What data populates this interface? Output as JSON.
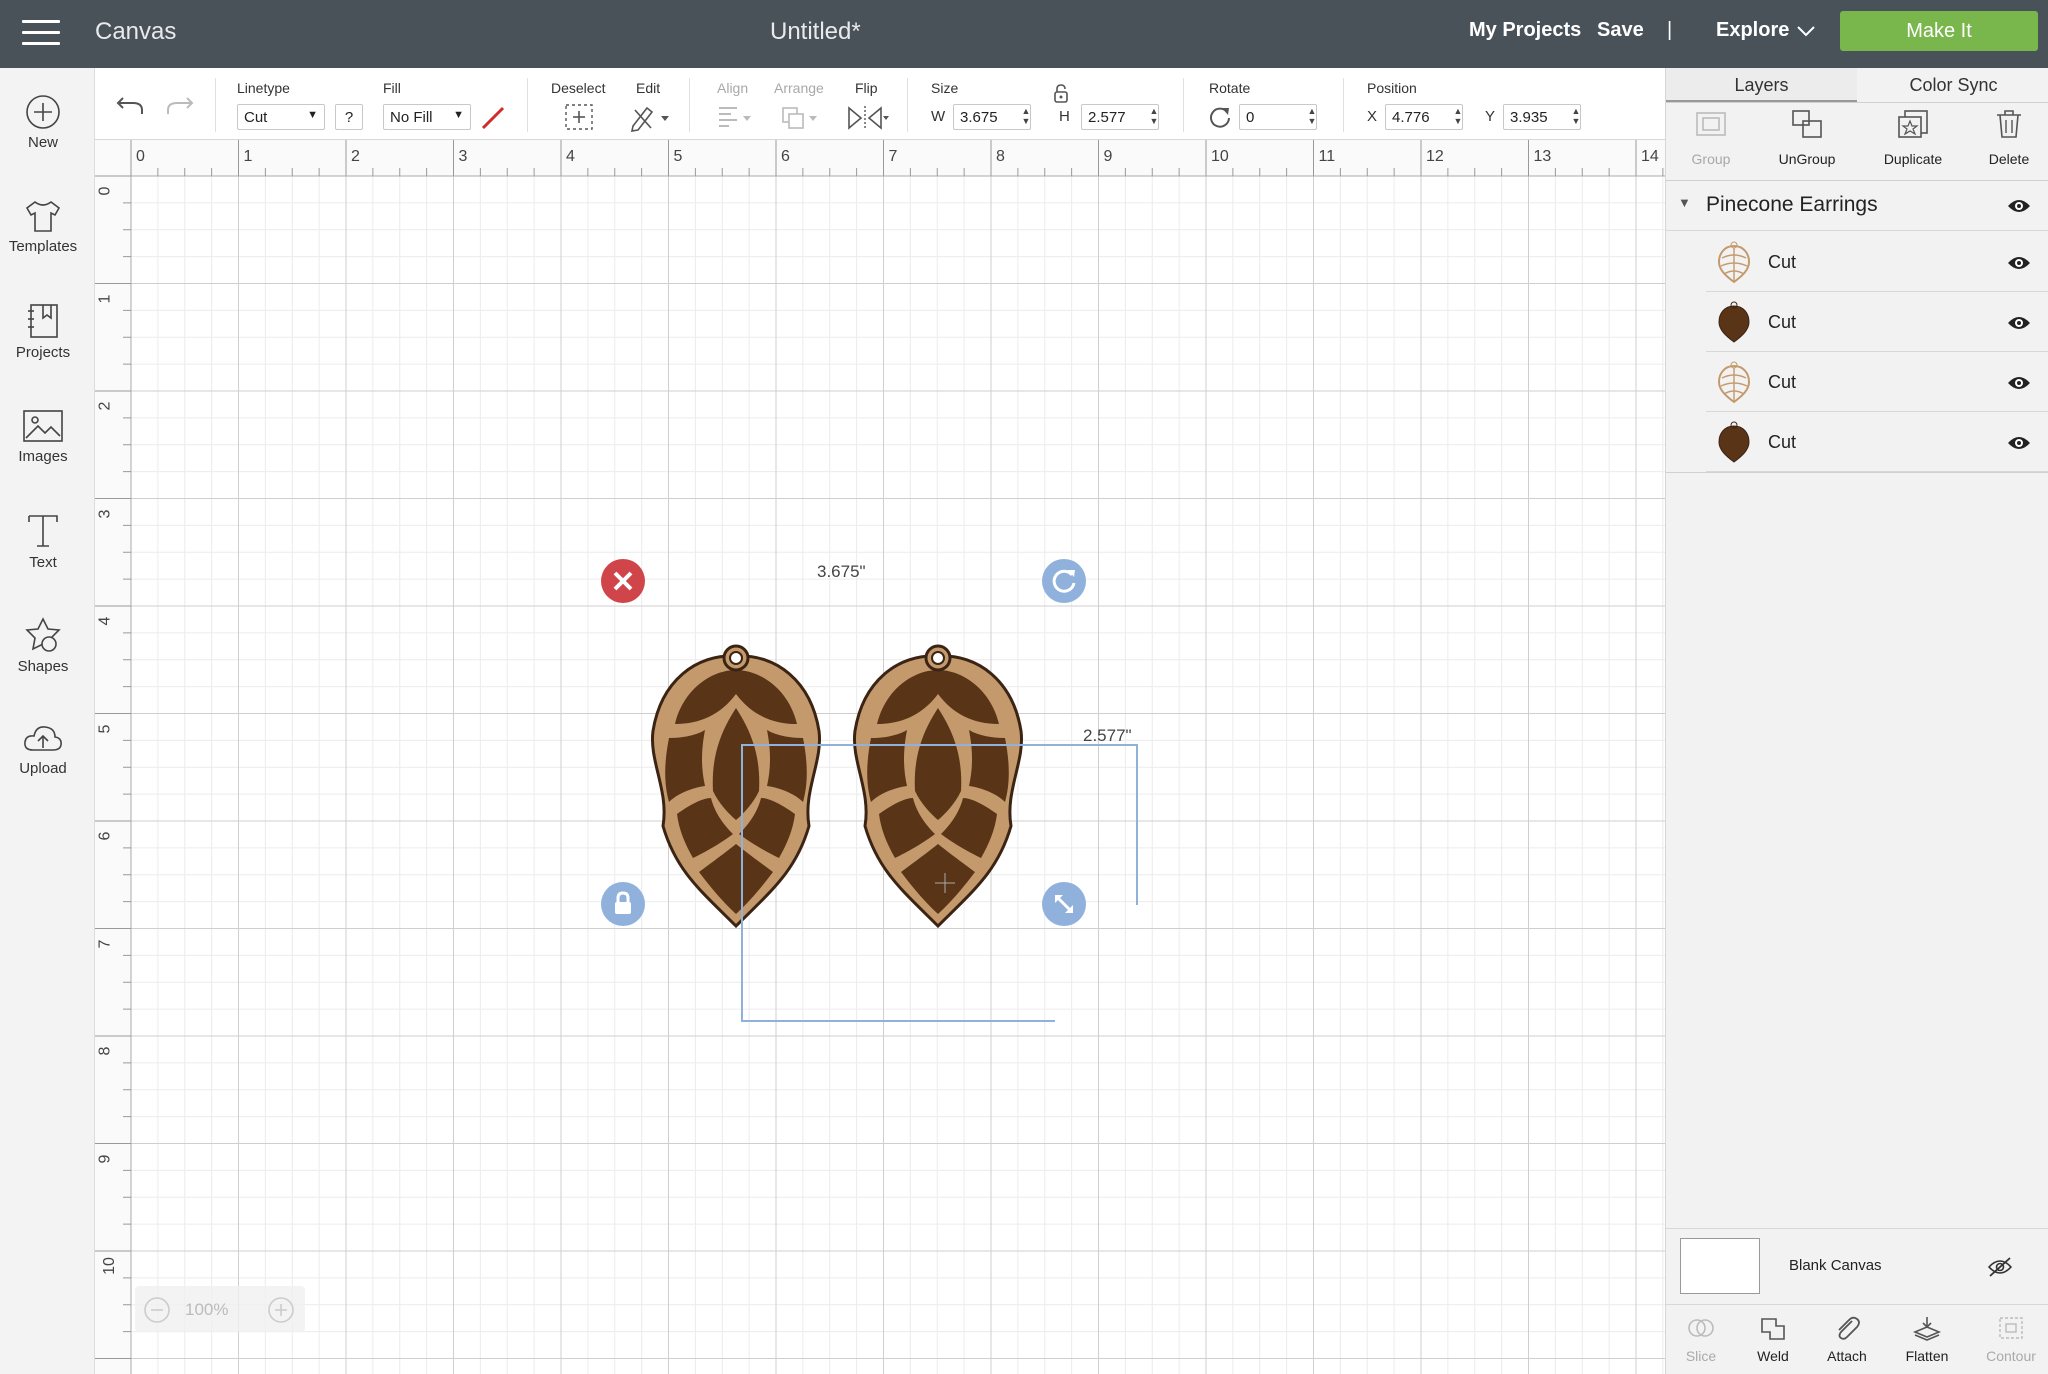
{
  "topbar": {
    "app_title": "Canvas",
    "doc_title": "Untitled*",
    "my_projects": "My Projects",
    "save": "Save",
    "divider": "|",
    "explore": "Explore",
    "make_it": "Make It"
  },
  "sidebar": {
    "items": [
      {
        "label": "New",
        "icon": "plus-circle-icon"
      },
      {
        "label": "Templates",
        "icon": "tshirt-icon"
      },
      {
        "label": "Projects",
        "icon": "notebook-icon"
      },
      {
        "label": "Images",
        "icon": "image-icon"
      },
      {
        "label": "Text",
        "icon": "text-icon"
      },
      {
        "label": "Shapes",
        "icon": "shapes-icon"
      },
      {
        "label": "Upload",
        "icon": "cloud-upload-icon"
      }
    ]
  },
  "toolbar": {
    "linetype_label": "Linetype",
    "linetype_value": "Cut",
    "help": "?",
    "fill_label": "Fill",
    "fill_value": "No Fill",
    "deselect_label": "Deselect",
    "edit_label": "Edit",
    "align_label": "Align",
    "arrange_label": "Arrange",
    "flip_label": "Flip",
    "size_label": "Size",
    "w_label": "W",
    "w_value": "3.675",
    "h_label": "H",
    "h_value": "2.577",
    "rotate_label": "Rotate",
    "rotate_value": "0",
    "position_label": "Position",
    "x_label": "X",
    "x_value": "4.776",
    "y_label": "Y",
    "y_value": "3.935"
  },
  "canvas": {
    "ruler_h": [
      "0",
      "1",
      "2",
      "3",
      "4",
      "5",
      "6",
      "7",
      "8",
      "9",
      "10",
      "11",
      "12",
      "13",
      "14"
    ],
    "ruler_v": [
      "0",
      "1",
      "2",
      "3",
      "4",
      "5",
      "6",
      "7",
      "8",
      "9",
      "10"
    ],
    "width_dim": "3.675\"",
    "height_dim": "2.577\"",
    "zoom": "100%"
  },
  "layers_panel": {
    "tab_layers": "Layers",
    "tab_color_sync": "Color Sync",
    "actions": {
      "group": "Group",
      "ungroup": "UnGroup",
      "duplicate": "Duplicate",
      "delete": "Delete"
    },
    "group_name": "Pinecone Earrings",
    "layers": [
      {
        "name": "Cut",
        "color": "#c49a6c",
        "kind": "outline"
      },
      {
        "name": "Cut",
        "color": "#5a3417",
        "kind": "solid"
      },
      {
        "name": "Cut",
        "color": "#c49a6c",
        "kind": "outline"
      },
      {
        "name": "Cut",
        "color": "#5a3417",
        "kind": "solid"
      }
    ],
    "blank_canvas": "Blank Canvas",
    "bottom_actions": {
      "slice": "Slice",
      "weld": "Weld",
      "attach": "Attach",
      "flatten": "Flatten",
      "contour": "Contour"
    }
  },
  "colors": {
    "topbar_bg": "#4a5259",
    "make_it_green": "#79b64b",
    "selection_blue": "#8fb1dc",
    "delete_red": "#d0454a",
    "cone_tan": "#c49a6c",
    "cone_brown": "#5a3417"
  }
}
